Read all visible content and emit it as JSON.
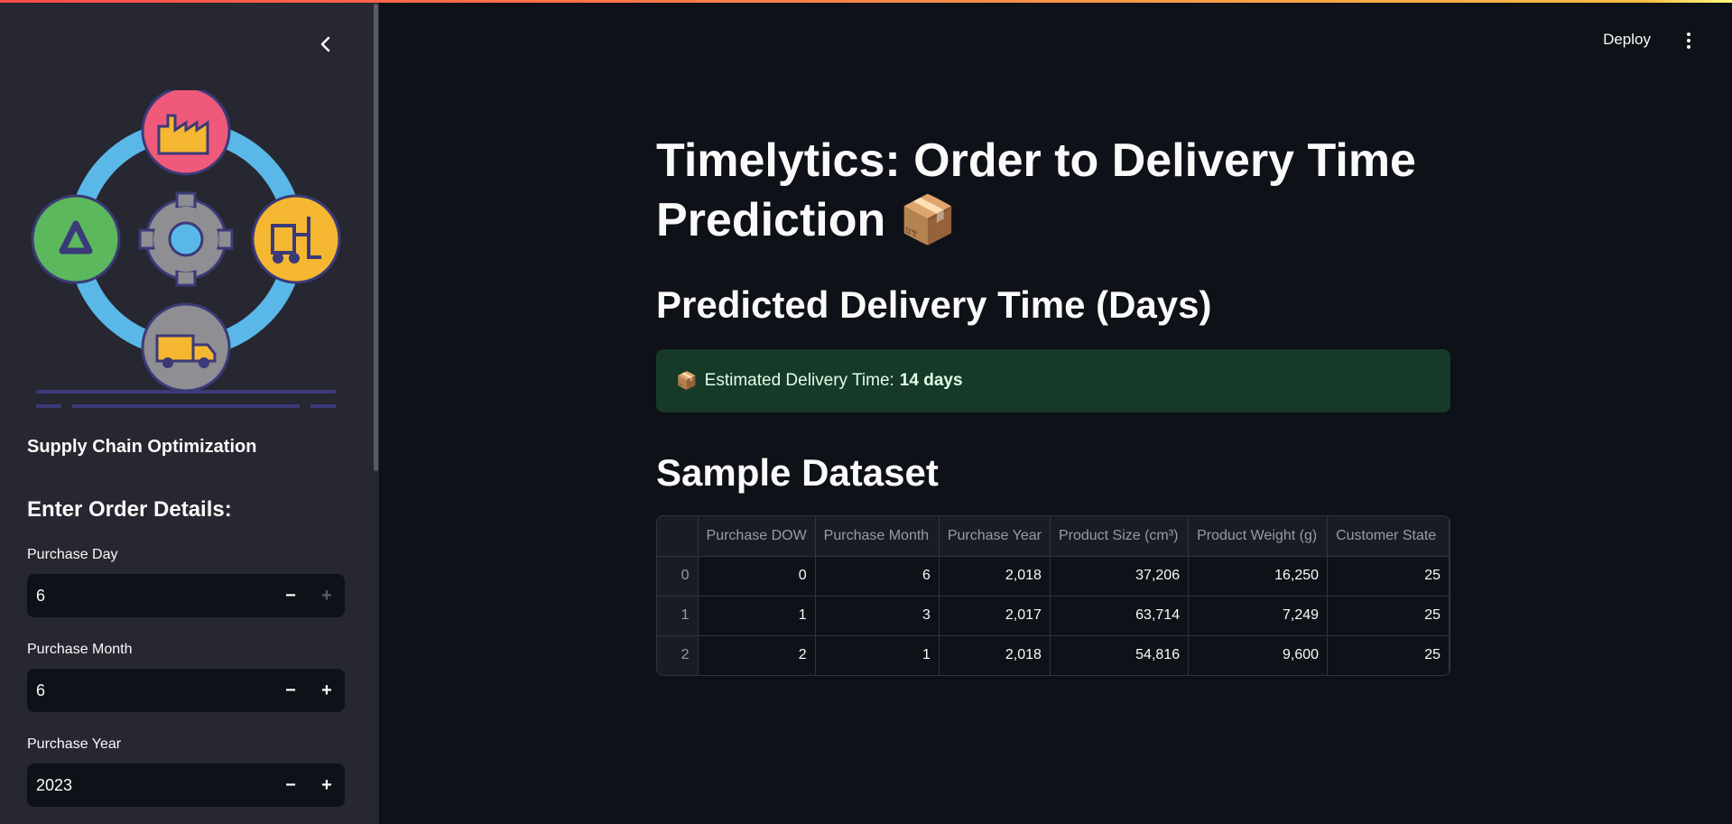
{
  "sidebar": {
    "collapse_icon": "chevron-left-icon",
    "logo_icon": "supply-chain-cycle-icon",
    "title": "Supply Chain Optimization",
    "heading": "Enter Order Details:",
    "fields": [
      {
        "label": "Purchase Day",
        "value": "6",
        "minus": "−",
        "plus": "+"
      },
      {
        "label": "Purchase Month",
        "value": "6",
        "minus": "−",
        "plus": "+"
      },
      {
        "label": "Purchase Year",
        "value": "2023",
        "minus": "−",
        "plus": "+"
      }
    ]
  },
  "header": {
    "deploy_label": "Deploy",
    "menu_icon": "vertical-dots-icon"
  },
  "main": {
    "title": "Timelytics: Order to Delivery Time Prediction 📦",
    "predicted_heading": "Predicted Delivery Time (Days)",
    "alert": {
      "icon": "📦",
      "text": "Estimated Delivery Time:",
      "value": "14 days"
    },
    "dataset_heading": "Sample Dataset",
    "table": {
      "columns": [
        "",
        "Purchase DOW",
        "Purchase Month",
        "Purchase Year",
        "Product Size (cm³)",
        "Product Weight (g)",
        "Customer State"
      ],
      "rows": [
        [
          "0",
          "0",
          "6",
          "2,018",
          "37,206",
          "16,250",
          "25"
        ],
        [
          "1",
          "1",
          "3",
          "2,017",
          "63,714",
          "7,249",
          "25"
        ],
        [
          "2",
          "2",
          "1",
          "2,018",
          "54,816",
          "9,600",
          "25"
        ]
      ]
    }
  },
  "colors": {
    "background": "#0e1117",
    "sidebar": "#262730",
    "success_bg": "#173928",
    "accent_gradient_start": "#ff4b4b",
    "accent_gradient_end": "#fffd80"
  }
}
